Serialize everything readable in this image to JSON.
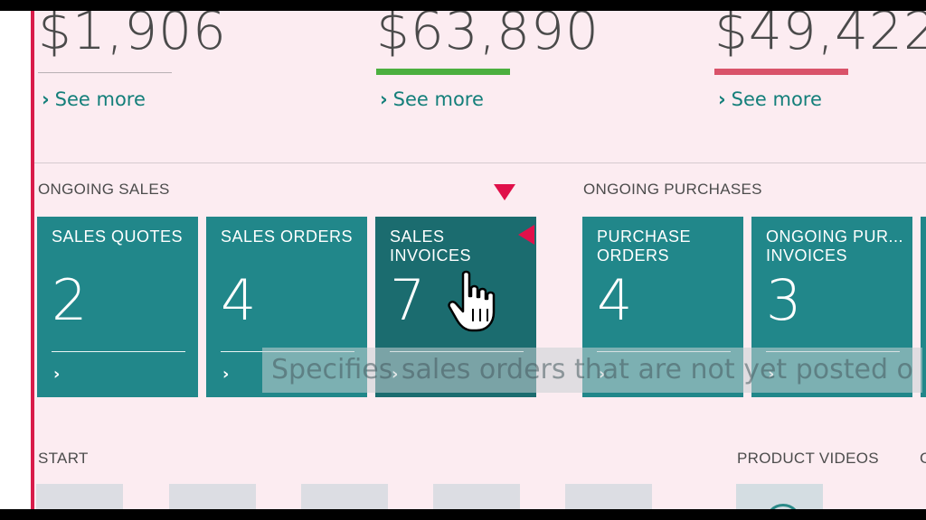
{
  "kpis": [
    {
      "value": "$1,906",
      "see_more": "See more",
      "indicator_color": "#b8b0b4"
    },
    {
      "value": "$63,890",
      "see_more": "See more",
      "indicator_color": "#4caf3f"
    },
    {
      "value": "$49,422",
      "see_more": "See more",
      "indicator_color": "#d9536a"
    }
  ],
  "ongoing_sales": {
    "label": "ONGOING SALES",
    "tiles": [
      {
        "title": "SALES QUOTES",
        "count": "2"
      },
      {
        "title": "SALES ORDERS",
        "count": "4"
      },
      {
        "title": "SALES INVOICES",
        "count": "7"
      }
    ]
  },
  "ongoing_purchases": {
    "label": "ONGOING PURCHASES",
    "tiles": [
      {
        "title": "PURCHASE ORDERS",
        "count": "4"
      },
      {
        "title": "ONGOING PUR... INVOICES",
        "count": "3"
      }
    ]
  },
  "tooltip": "Specifies sales orders that are not yet posted o",
  "start": {
    "label": "START"
  },
  "product_videos": {
    "label": "PRODUCT VIDEOS"
  },
  "colors": {
    "tile": "#21878a",
    "tile_selected": "#1b6c6f",
    "accent": "#d81c4a",
    "link": "#147f7a",
    "background": "#fcecf1"
  },
  "icons": [
    "chevron-right-icon",
    "hand-pointer-cursor-icon",
    "play-icon"
  ]
}
